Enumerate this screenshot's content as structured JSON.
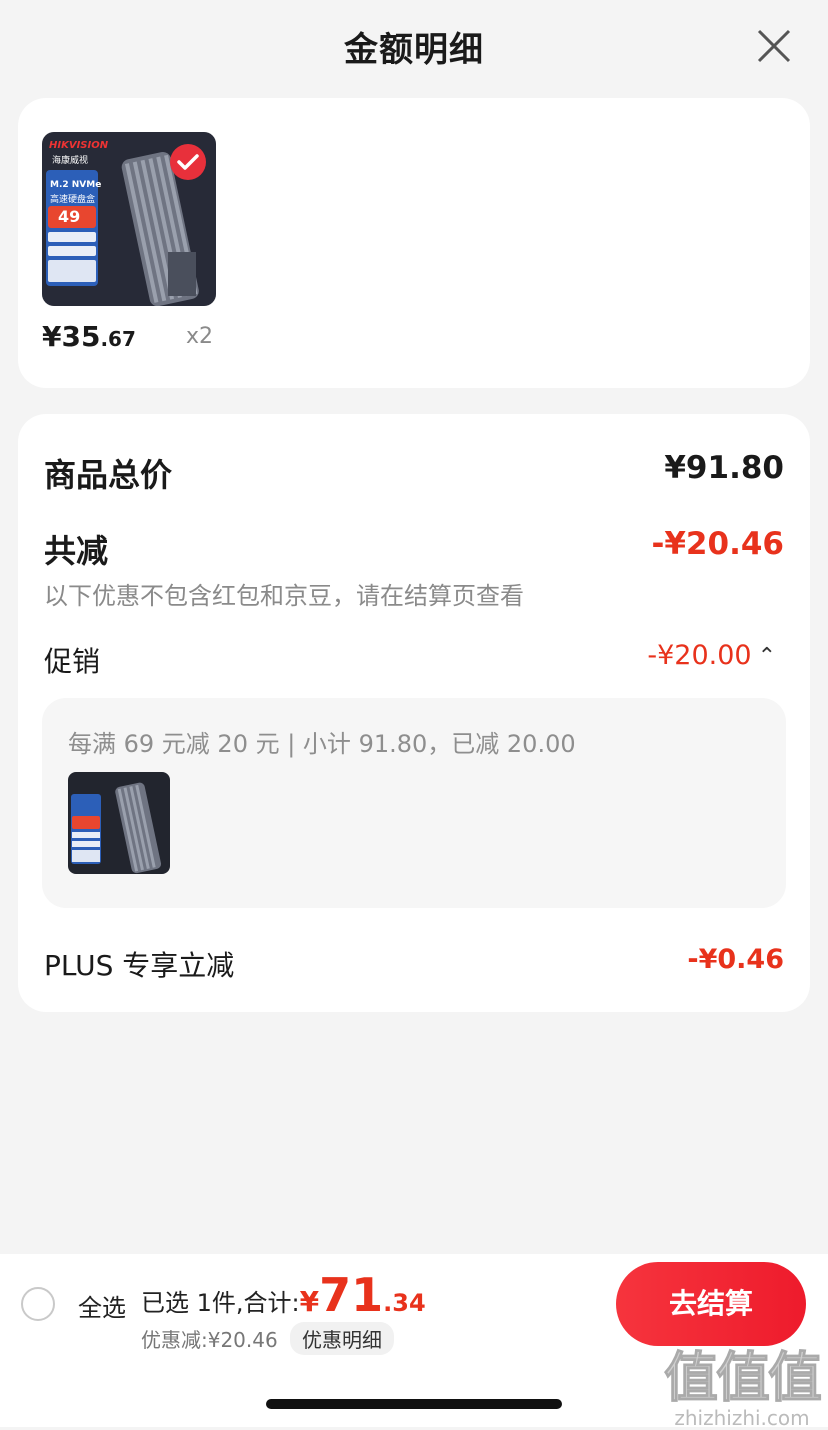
{
  "header": {
    "title": "金额明细"
  },
  "product": {
    "brand_logo": "HIKVISION",
    "brand_cn": "海康威视",
    "thumb_lines": [
      "M.2 NVMe",
      "高速硬盘盒",
      "49"
    ],
    "price_main": "¥35",
    "price_decimal": ".67",
    "quantity": "x2"
  },
  "summary": {
    "total_label": "商品总价",
    "total_value": "¥91.80",
    "reduced_label": "共减",
    "reduced_value": "-¥20.46",
    "note": "以下优惠不包含红包和京豆，请在结算页查看",
    "promo_label": "促销",
    "promo_value": "-¥20.00",
    "promo_detail": "每满 69 元减 20 元 | 小计 91.80，已减 20.00",
    "plus_label": "PLUS 专享立减",
    "plus_value": "-¥0.46"
  },
  "bottom_bar": {
    "select_all": "全选",
    "selected_text": "已选 1件,合计:",
    "total_currency": "¥",
    "total_integer": "71",
    "total_decimal": ".34",
    "discount_text": "优惠减:¥20.46",
    "detail_link": "优惠明细",
    "checkout_label": "去结算"
  },
  "watermark": {
    "logo": "值值值",
    "url": "zhizhizhi.com"
  },
  "colors": {
    "accent_red": "#e8321c",
    "checkout_red": "#f3283a",
    "background": "#f4f4f4"
  }
}
